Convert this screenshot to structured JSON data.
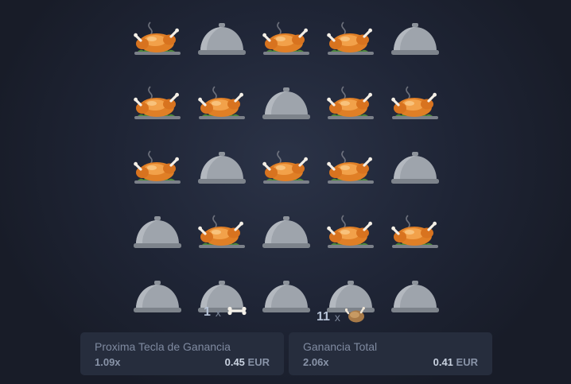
{
  "board": {
    "grid": [
      [
        "chicken",
        "dome",
        "chicken",
        "chicken",
        "dome"
      ],
      [
        "chicken",
        "chicken",
        "dome",
        "chicken",
        "chicken"
      ],
      [
        "chicken",
        "dome",
        "chicken",
        "chicken",
        "dome"
      ],
      [
        "dome",
        "chicken",
        "dome",
        "chicken",
        "chicken"
      ],
      [
        "dome",
        "dome",
        "dome",
        "dome",
        "dome"
      ]
    ]
  },
  "counters": {
    "bones": {
      "count": "1",
      "times": "x",
      "icon": "bone-icon"
    },
    "chickens": {
      "count": "11",
      "times": "x",
      "icon": "chicken-icon"
    }
  },
  "panels": {
    "next": {
      "title": "Proxima Tecla de Ganancia",
      "multiplier": "1.09x",
      "amount": "0.45",
      "currency": "EUR"
    },
    "total": {
      "title": "Ganancia Total",
      "multiplier": "2.06x",
      "amount": "0.41",
      "currency": "EUR"
    }
  },
  "colors": {
    "background": "#1f2536",
    "panel": "#262d3d",
    "dome": "#9aa0a8",
    "chicken": "#e98a2e"
  }
}
